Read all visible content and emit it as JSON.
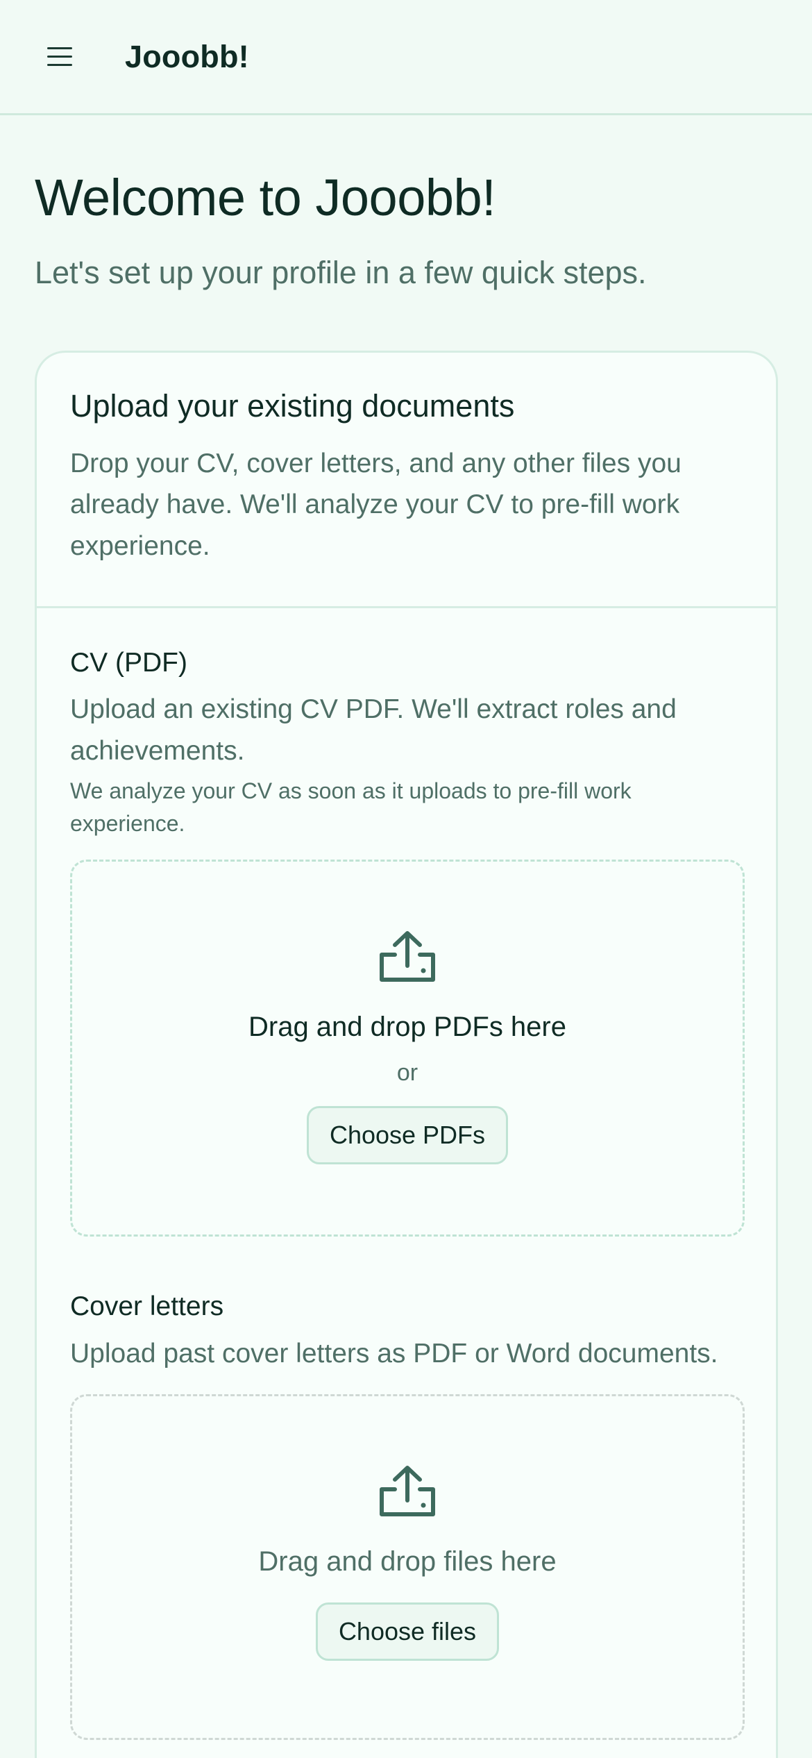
{
  "header": {
    "brand": "Jooobb!",
    "menu_icon": "menu-icon"
  },
  "intro": {
    "title": "Welcome to Jooobb!",
    "subtitle": "Let's set up your profile in a few quick steps."
  },
  "upload_card": {
    "title": "Upload your existing documents",
    "description": "Drop your CV, cover letters, and any other files you already have. We'll analyze your CV to pre-fill work experience.",
    "cv": {
      "title": "CV (PDF)",
      "description": "Upload an existing CV PDF. We'll extract roles and achievements.",
      "note": "We analyze your CV as soon as it uploads to pre-fill work experience.",
      "dropzone_text": "Drag and drop PDFs here",
      "or_text": "or",
      "button_label": "Choose PDFs",
      "icon": "upload-icon"
    },
    "cover_letters": {
      "title": "Cover letters",
      "description": "Upload past cover letters as PDF or Word documents.",
      "dropzone_text": "Drag and drop files here",
      "button_label": "Choose files",
      "icon": "upload-icon"
    }
  },
  "colors": {
    "background": "#f1faf5",
    "card_background": "#f8fefb",
    "border": "#d6ede3",
    "text_primary": "#0f2b24",
    "text_muted": "#4f6f66",
    "icon": "#3d6a5d"
  }
}
